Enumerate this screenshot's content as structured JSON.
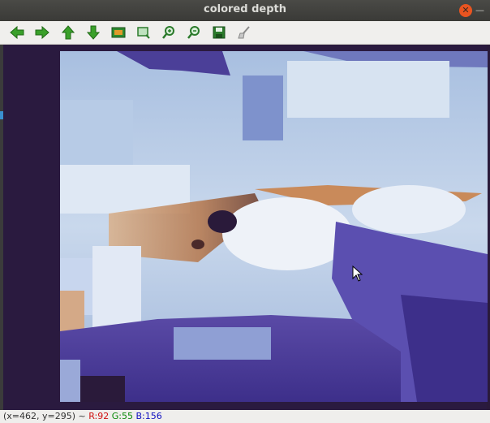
{
  "window": {
    "title": "colored depth",
    "close_glyph": "✕",
    "minimize_glyph": "—"
  },
  "toolbar": {
    "buttons": [
      {
        "name": "back-arrow-icon",
        "color": "#3aa02a"
      },
      {
        "name": "forward-arrow-icon",
        "color": "#3aa02a"
      },
      {
        "name": "up-arrow-icon",
        "color": "#3aa02a"
      },
      {
        "name": "down-arrow-icon",
        "color": "#3aa02a"
      },
      {
        "name": "image-icon",
        "color": "#2b7a2b"
      },
      {
        "name": "zoom-rect-icon",
        "color": "#2b7a2b"
      },
      {
        "name": "zoom-in-icon",
        "color": "#2b7a2b"
      },
      {
        "name": "zoom-out-icon",
        "color": "#2b7a2b"
      },
      {
        "name": "save-icon",
        "color": "#2b7a2b"
      },
      {
        "name": "properties-brush-icon",
        "color": "#888888"
      }
    ]
  },
  "status": {
    "coords": "(x=462, y=295) ~",
    "r": "R:92",
    "g": "G:55",
    "b": "B:156"
  },
  "colors": {
    "accent_close": "#e95420",
    "depth_dark": "#3d2f8a",
    "depth_light": "#dfe7f2",
    "depth_warm": "#b5764a"
  }
}
